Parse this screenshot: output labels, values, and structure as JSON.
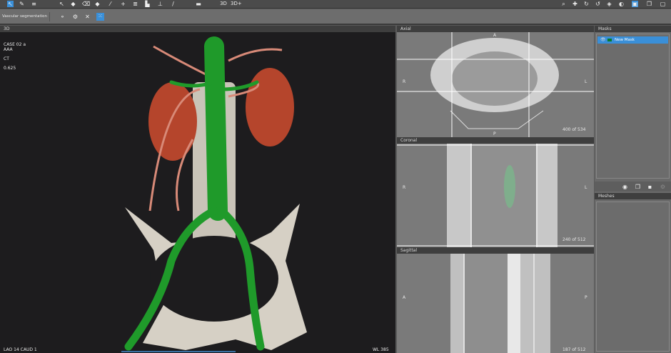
{
  "toolbar": {
    "icons": [
      "pointer-icon",
      "brush-icon",
      "list-icon",
      "select-icon",
      "paint-icon",
      "eraser-icon",
      "fill-icon",
      "wand-icon",
      "threshold-icon",
      "layers-icon",
      "crop-icon",
      "split-icon",
      "pen-icon",
      "separator-line-icon"
    ],
    "view_2d_label": "3D",
    "view_3d_plus_label": "3D+",
    "right_icons": [
      "zoom-icon",
      "pan-icon",
      "rotate-icon",
      "reset-icon",
      "window-level-icon",
      "contrast-icon",
      "layout-icon",
      "copy-icon",
      "export-icon"
    ]
  },
  "subtoolbar": {
    "title": "Vascular segmentation",
    "tools": [
      "add-seed-icon",
      "remove-seed-icon",
      "shrink-icon",
      "expand-icon"
    ]
  },
  "view3d": {
    "header": "3D",
    "case": "CASE 02 a",
    "study": "AAA",
    "modality": "CT",
    "thickness": "0.625",
    "orientation": "LAO 14  CAUD 1",
    "wl": "WL 385"
  },
  "axial": {
    "header": "Axial",
    "top": "A",
    "bottom": "P",
    "left": "R",
    "right": "L",
    "slice": "400 of 534"
  },
  "coronal": {
    "header": "Coronal",
    "left": "R",
    "right": "L",
    "slice": "240 of 512"
  },
  "sagittal": {
    "header": "Sagittal",
    "left": "A",
    "right": "P",
    "slice": "187 of 512"
  },
  "masks": {
    "header": "Masks",
    "items": [
      {
        "name": "New Mask",
        "color": "#0a7a2a"
      }
    ],
    "actions": [
      "visibility-icon",
      "duplicate-icon",
      "delete-icon",
      "settings-icon"
    ]
  },
  "meshes": {
    "header": "Meshes"
  },
  "colors": {
    "accent": "#3a8fd8",
    "vessel": "#1f9a2a",
    "kidney": "#b5452c"
  }
}
